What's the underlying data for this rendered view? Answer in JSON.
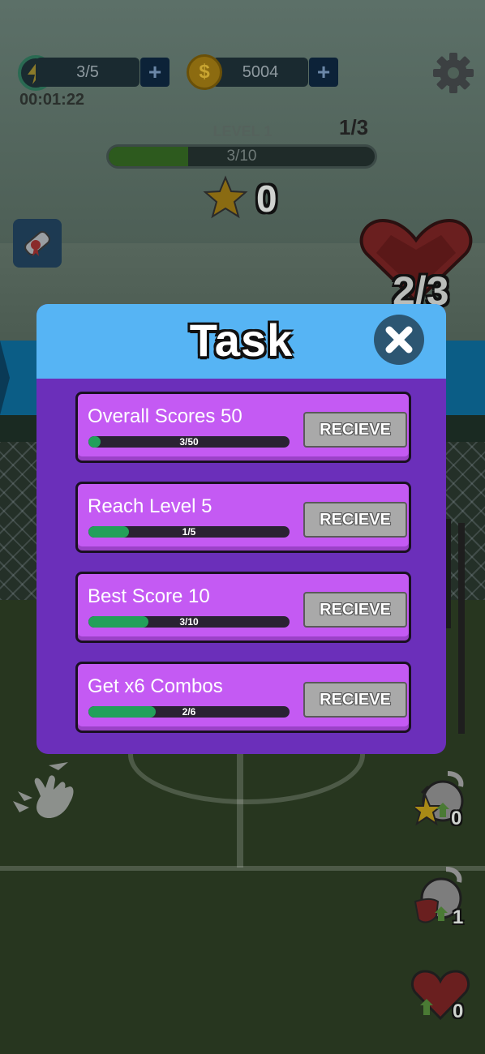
{
  "hud": {
    "energy": "3/5",
    "timer": "00:01:22",
    "coins": "5004",
    "level": "LEVEL 1",
    "stage": "1/3",
    "progress_text": "3/10",
    "progress_fraction": 0.3,
    "stars": "0",
    "hearts": "2/3",
    "plus": "+"
  },
  "task_dialog": {
    "title": "Task",
    "tasks": [
      {
        "label": "Overall Scores 50",
        "progress": "3/50",
        "fraction": 0.06,
        "button": "RECIEVE"
      },
      {
        "label": "Reach Level 5",
        "progress": "1/5",
        "fraction": 0.2,
        "button": "RECIEVE"
      },
      {
        "label": "Best Score 10",
        "progress": "3/10",
        "fraction": 0.3,
        "button": "RECIEVE"
      },
      {
        "label": "Get x6 Combos",
        "progress": "2/6",
        "fraction": 0.333,
        "button": "RECIEVE"
      }
    ]
  },
  "boosters": {
    "star_lock_count": "0",
    "shield_lock_count": "1",
    "heart_count": "0"
  },
  "colors": {
    "dialog_bg": "#6b2fba",
    "dialog_header": "#56b4f4",
    "task_card": "#c45af3",
    "progress_fill": "#22a05a",
    "button_gray": "#a9a9a9"
  }
}
